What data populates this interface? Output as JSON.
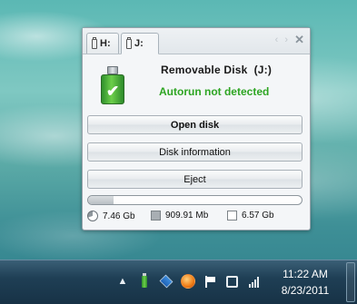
{
  "gadget": {
    "tabs": [
      {
        "label": "H:",
        "active": false
      },
      {
        "label": "J:",
        "active": true
      }
    ],
    "nav_arrows": "‹ ›",
    "close_glyph": "✕",
    "disk_title": "Removable Disk  (J:)",
    "autorun_status": "Autorun not detected",
    "autorun_color": "#2ea523",
    "buttons": {
      "open": "Open disk",
      "info": "Disk information",
      "eject": "Eject"
    },
    "usage_fraction": 0.12,
    "stats": {
      "total": "7.46 Gb",
      "used": "909.91 Mb",
      "free": "6.57 Gb"
    }
  },
  "taskbar": {
    "tray_icons": [
      "chevron-up-icon",
      "usb-drive-icon",
      "dropbox-icon",
      "orange-app-icon",
      "action-center-flag-icon",
      "network-icon",
      "signal-strength-icon"
    ],
    "time": "11:22 AM",
    "date": "8/23/2011"
  }
}
